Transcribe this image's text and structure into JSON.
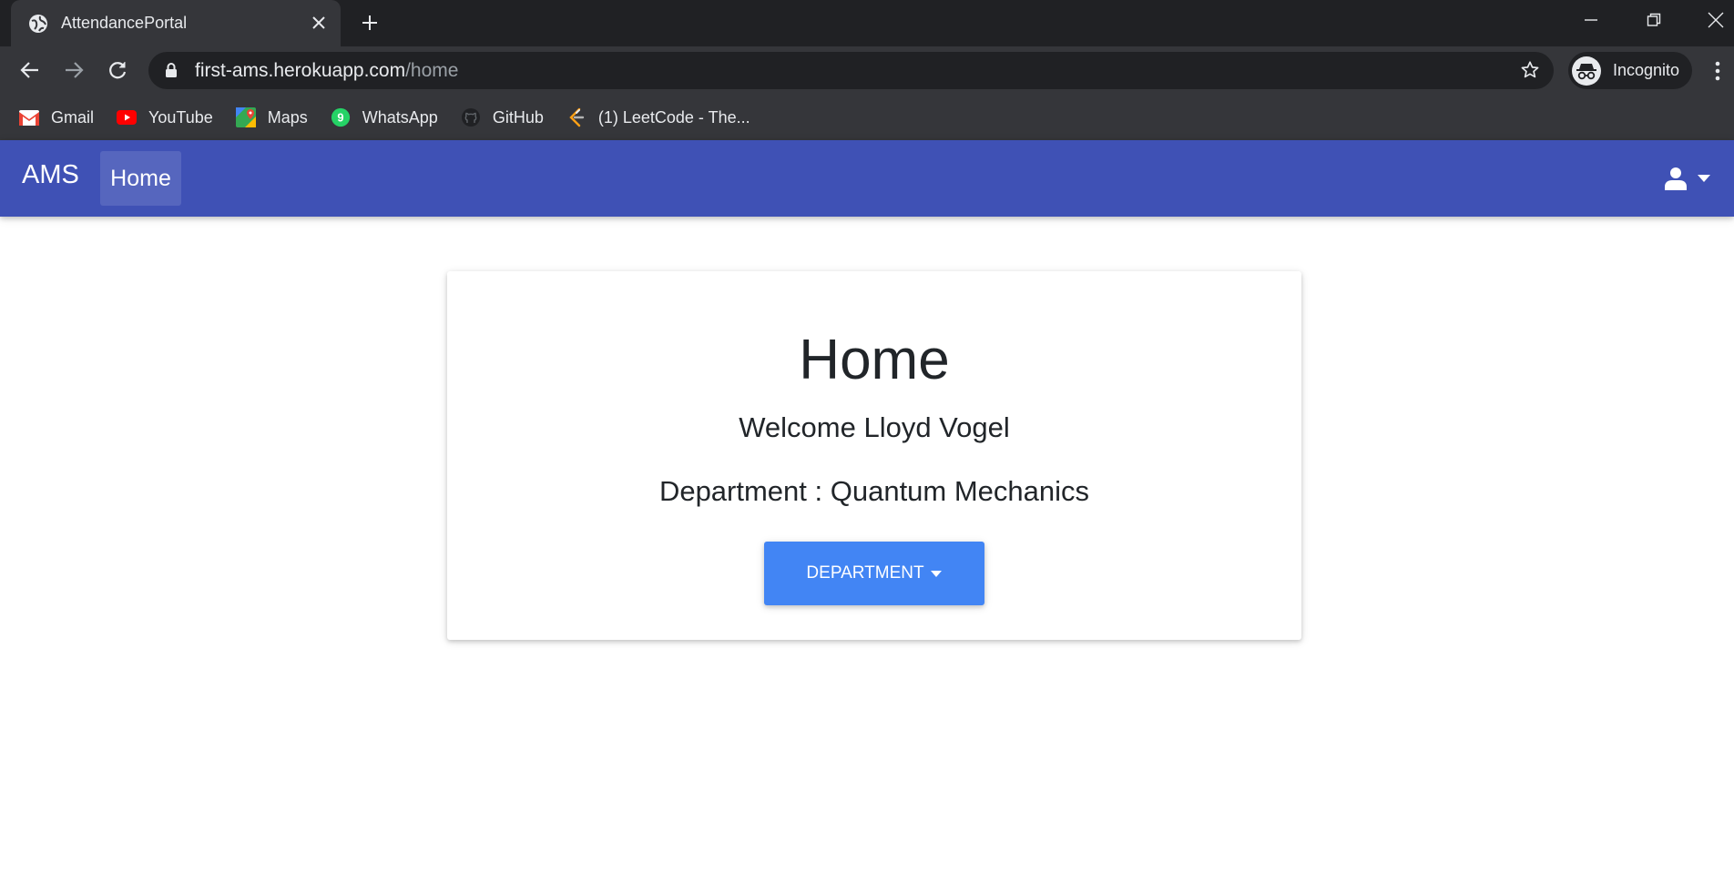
{
  "browser": {
    "tab": {
      "title": "AttendancePortal",
      "favicon": "globe-icon"
    },
    "url": {
      "host": "first-ams.herokuapp.com",
      "path": "/home"
    },
    "profile_label": "Incognito",
    "bookmarks": [
      {
        "label": "Gmail",
        "icon": "gmail-icon"
      },
      {
        "label": "YouTube",
        "icon": "youtube-icon"
      },
      {
        "label": "Maps",
        "icon": "maps-icon"
      },
      {
        "label": "WhatsApp",
        "icon": "whatsapp-icon"
      },
      {
        "label": "GitHub",
        "icon": "github-icon"
      },
      {
        "label": "(1) LeetCode - The...",
        "icon": "leetcode-icon"
      }
    ]
  },
  "navbar": {
    "brand": "AMS",
    "home_label": "Home",
    "color": "#3f51b5"
  },
  "card": {
    "title": "Home",
    "welcome": "Welcome Lloyd Vogel",
    "department": "Department : Quantum Mechanics",
    "button_label": "DEPARTMENT",
    "button_color": "#4285f4"
  }
}
